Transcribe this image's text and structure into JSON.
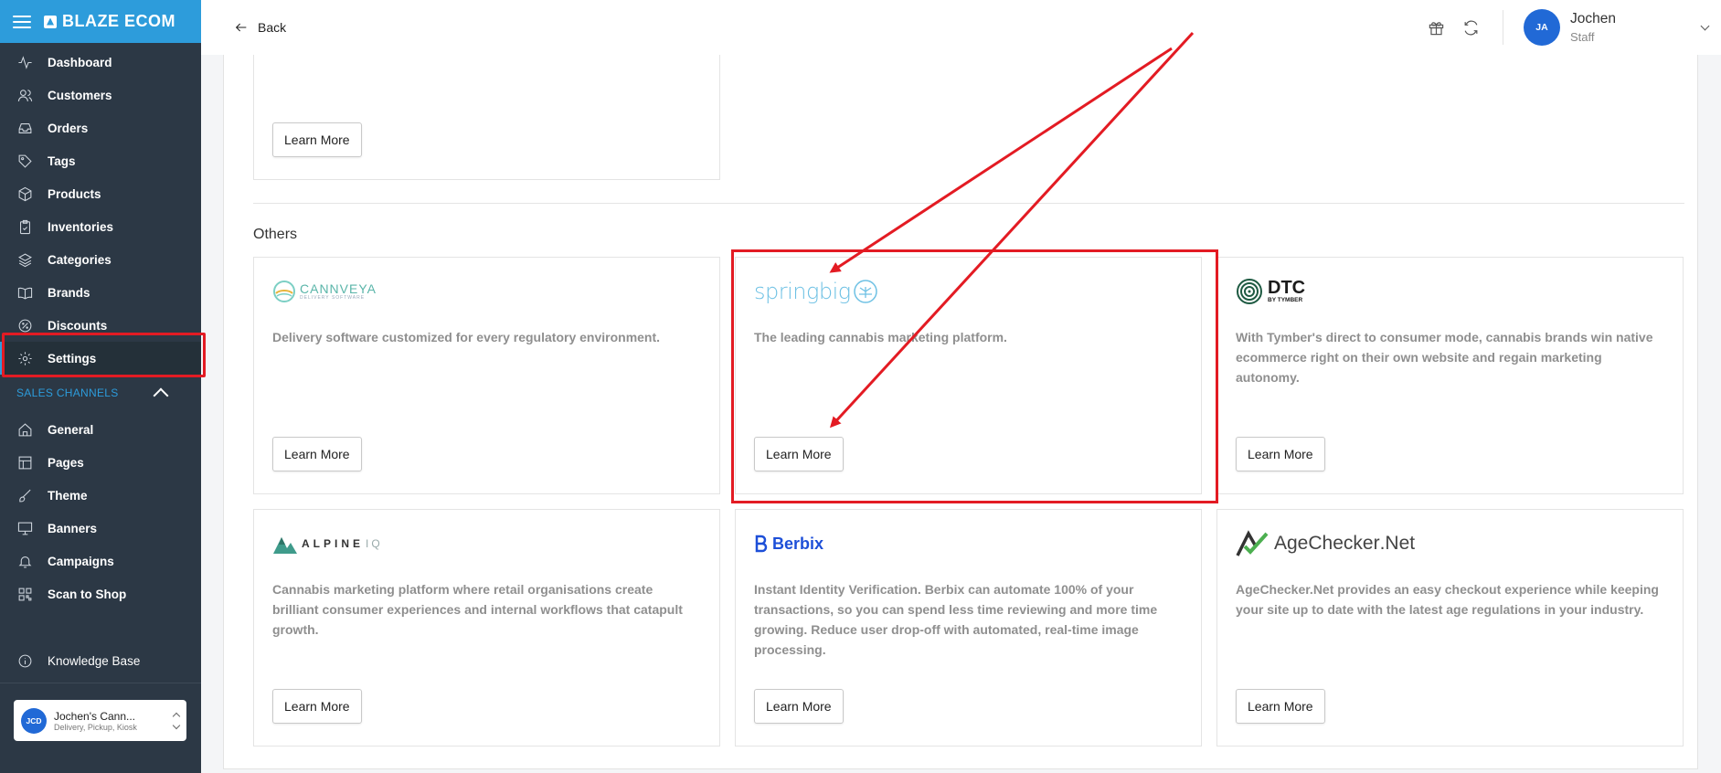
{
  "app": {
    "brand": "BLAZE ECOM"
  },
  "sidebar": {
    "items": [
      {
        "label": "Dashboard",
        "icon": "activity-icon"
      },
      {
        "label": "Customers",
        "icon": "users-icon"
      },
      {
        "label": "Orders",
        "icon": "inbox-icon"
      },
      {
        "label": "Tags",
        "icon": "tag-icon"
      },
      {
        "label": "Products",
        "icon": "box-icon"
      },
      {
        "label": "Inventories",
        "icon": "clipboard-icon"
      },
      {
        "label": "Categories",
        "icon": "layers-icon"
      },
      {
        "label": "Brands",
        "icon": "book-icon"
      },
      {
        "label": "Discounts",
        "icon": "discount-icon"
      },
      {
        "label": "Settings",
        "icon": "gear-icon"
      }
    ],
    "sales_channels_label": "SALES CHANNELS",
    "channels": [
      {
        "label": "General",
        "icon": "home-icon"
      },
      {
        "label": "Pages",
        "icon": "layout-icon"
      },
      {
        "label": "Theme",
        "icon": "brush-icon"
      },
      {
        "label": "Banners",
        "icon": "monitor-icon"
      },
      {
        "label": "Campaigns",
        "icon": "bell-icon"
      },
      {
        "label": "Scan to Shop",
        "icon": "qr-icon"
      }
    ],
    "knowledge_base": "Knowledge Base",
    "store": {
      "initials": "JCD",
      "name": "Jochen's Cann...",
      "subtitle": "Delivery, Pickup, Kiosk"
    }
  },
  "header": {
    "back_label": "Back",
    "user": {
      "initials": "JA",
      "name": "Jochen",
      "role": "Staff"
    }
  },
  "main": {
    "learn_more_label": "Learn More",
    "others_title": "Others",
    "cards": [
      {
        "logo": "CANNVEYA",
        "logo_sub": "DELIVERY SOFTWARE",
        "description": "Delivery software customized for every regulatory environment."
      },
      {
        "logo": "springbig",
        "description": "The leading cannabis marketing platform."
      },
      {
        "logo": "DTC",
        "logo_sub": "BY TYMBER",
        "description": "With Tymber's direct to consumer mode, cannabis brands win native ecommerce right on their own website and regain marketing autonomy."
      },
      {
        "logo": "ALPINE",
        "logo_sub": "IQ",
        "description": "Cannabis marketing platform where retail organisations create brilliant consumer experiences and internal workflows that catapult growth."
      },
      {
        "logo": "Berbix",
        "description": "Instant Identity Verification. Berbix can automate 100% of your transactions, so you can spend less time reviewing and more time growing. Reduce user drop-off with automated, real-time image processing."
      },
      {
        "logo": "AgeChecker",
        "logo_sub": ".Net",
        "description": "AgeChecker.Net provides an easy checkout experience while keeping your site up to date with the latest age regulations in your industry."
      }
    ]
  },
  "colors": {
    "sidebar_bg": "#2c3845",
    "accent": "#2d9cdb",
    "annotation_red": "#e31b23",
    "avatar_blue": "#2169d6"
  }
}
